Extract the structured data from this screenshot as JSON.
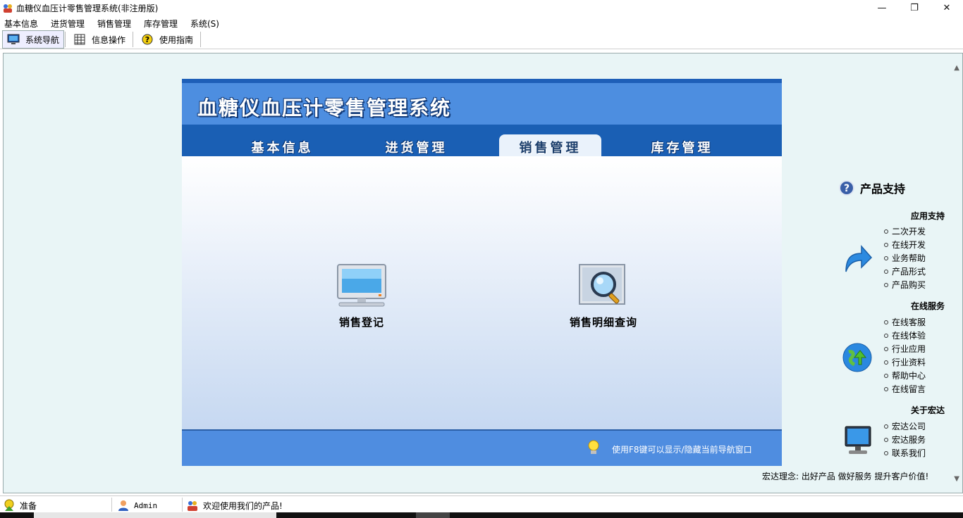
{
  "window": {
    "title": "血糖仪血压计零售管理系统(非注册版)"
  },
  "menubar": [
    {
      "label": "基本信息"
    },
    {
      "label": "进货管理"
    },
    {
      "label": "销售管理"
    },
    {
      "label": "库存管理"
    },
    {
      "label": "系统(S)"
    }
  ],
  "toolbar": [
    {
      "label": "系统导航",
      "icon": "monitor-icon",
      "active": true
    },
    {
      "label": "信息操作",
      "icon": "grid-icon",
      "active": false
    },
    {
      "label": "使用指南",
      "icon": "help-icon",
      "active": false
    }
  ],
  "panel": {
    "title": "血糖仪血压计零售管理系统",
    "tabs": [
      {
        "label": "基本信息",
        "active": false
      },
      {
        "label": "进货管理",
        "active": false
      },
      {
        "label": "销售管理",
        "active": true
      },
      {
        "label": "库存管理",
        "active": false
      }
    ],
    "features": [
      {
        "label": "销售登记",
        "icon": "computer-monitor-icon"
      },
      {
        "label": "销售明细查询",
        "icon": "magnifier-icon"
      }
    ],
    "footer_hint": "使用F8键可以显示/隐藏当前导航窗口"
  },
  "sidebar": {
    "heading": "产品支持",
    "sections": [
      {
        "title": "应用支持",
        "icon": "arrow-icon",
        "items": [
          "二次开发",
          "在线开发",
          "业务帮助",
          "产品形式",
          "产品购买"
        ]
      },
      {
        "title": "在线服务",
        "icon": "globe-icon",
        "items": [
          "在线客服",
          "在线体验",
          "行业应用",
          "行业资料",
          "帮助中心",
          "在线留言"
        ]
      },
      {
        "title": "关于宏达",
        "icon": "desktop-icon",
        "items": [
          "宏达公司",
          "宏达服务",
          "联系我们"
        ]
      }
    ],
    "slogan": "宏达理念: 出好产品  做好服务  提升客户价值!"
  },
  "statusbar": {
    "status": "准备",
    "user": "Admin",
    "welcome": "欢迎使用我们的产品!"
  },
  "colors": {
    "accent": "#1a5fb4",
    "panel_head": "#4d8ee0",
    "workspace_bg": "#e9f5f6"
  }
}
